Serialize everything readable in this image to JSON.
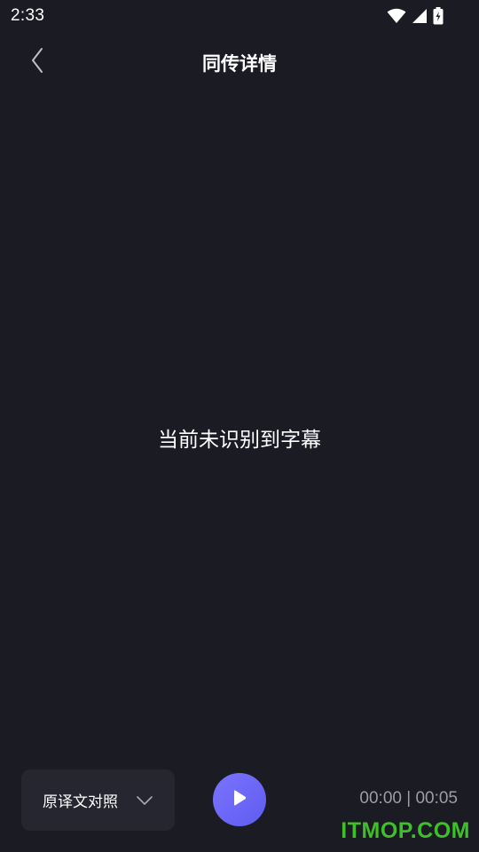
{
  "status_bar": {
    "time": "2:33",
    "icons": [
      "wifi-icon",
      "cellular-signal-icon",
      "battery-charging-icon"
    ]
  },
  "header": {
    "back_icon": "chevron-left-icon",
    "title": "同传详情"
  },
  "main": {
    "empty_message": "当前未识别到字幕"
  },
  "controls": {
    "mode_select": {
      "selected": "原译文对照",
      "icon": "chevron-down-icon"
    },
    "play_icon": "play-icon",
    "time_display": "00:00 | 00:05",
    "accent_color": "#6b66f8"
  },
  "watermark": {
    "text": "ITMOP.COM",
    "color": "#3fbf2a"
  }
}
